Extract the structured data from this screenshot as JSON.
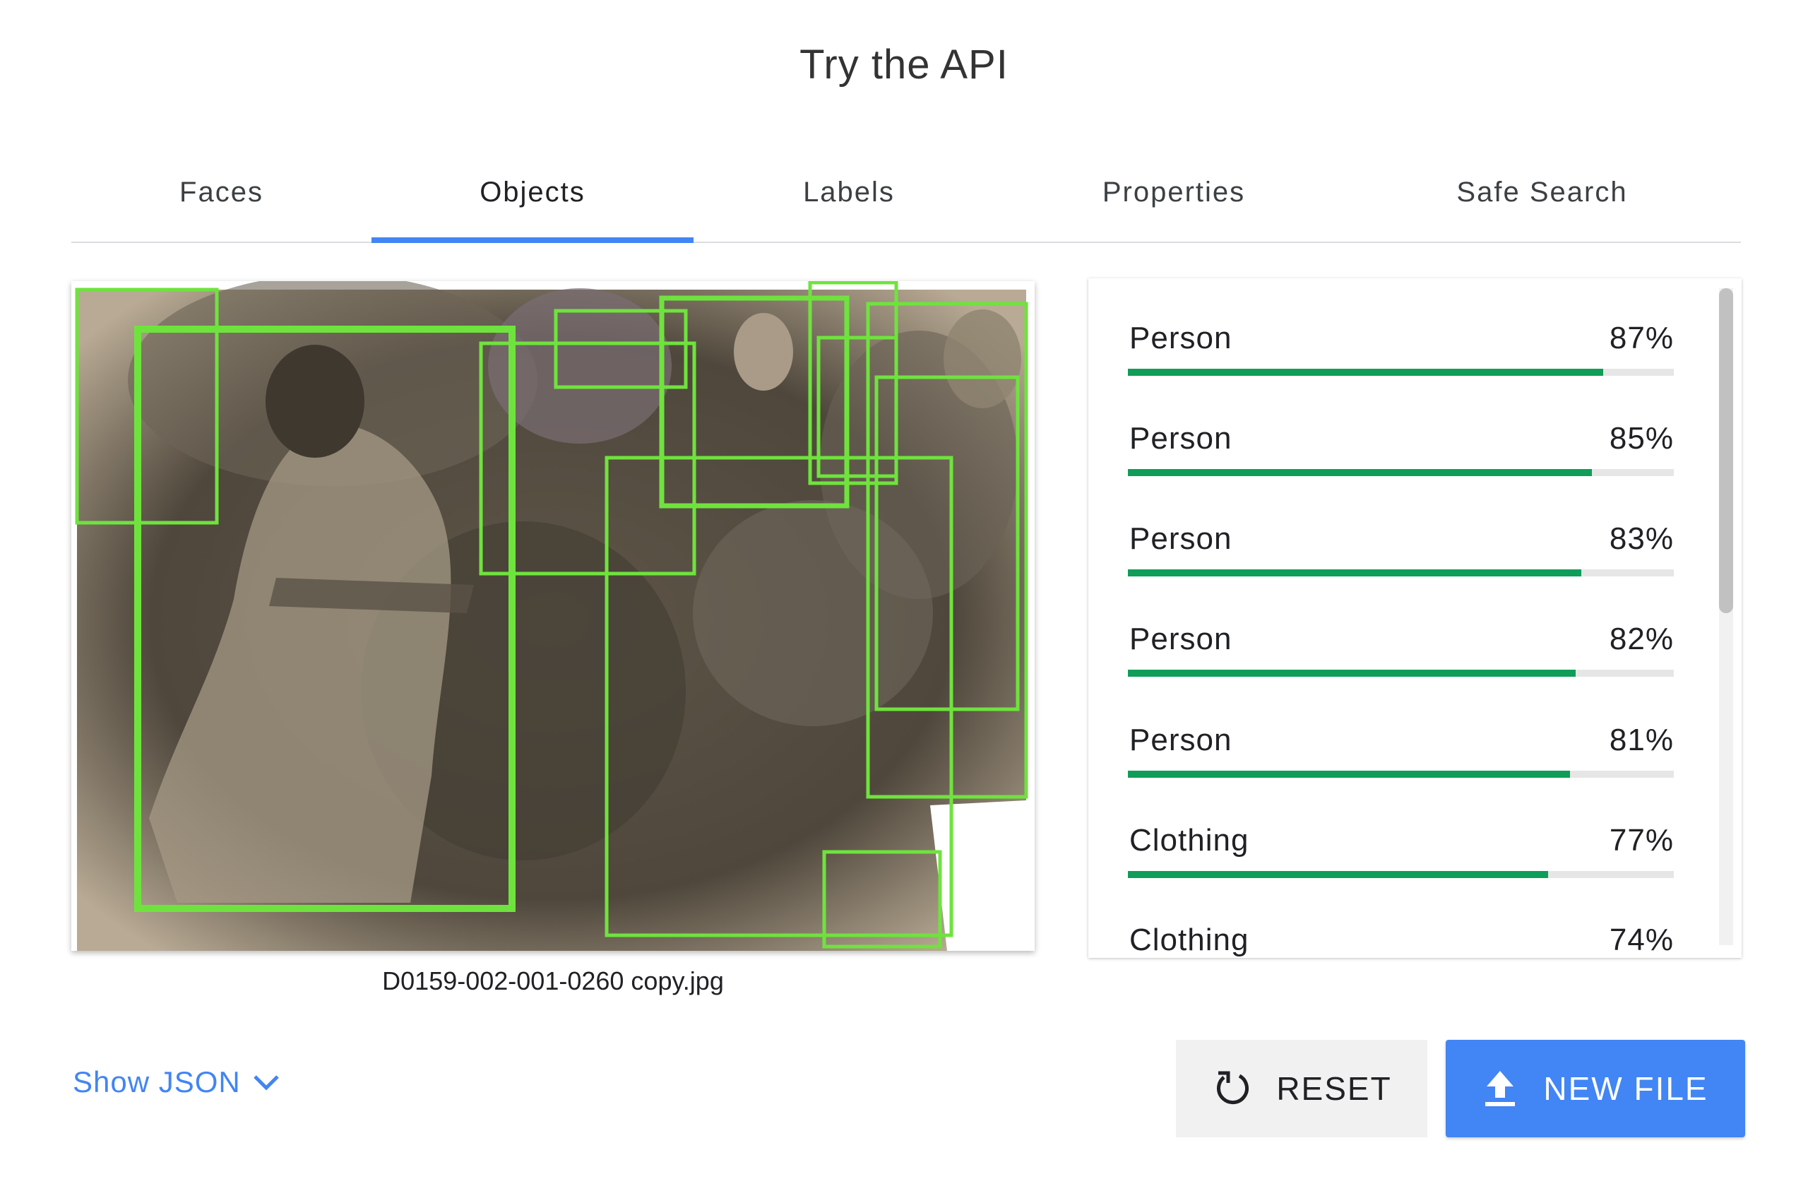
{
  "page": {
    "title": "Try the API"
  },
  "tabs": [
    {
      "label": "Faces",
      "active": false
    },
    {
      "label": "Objects",
      "active": true
    },
    {
      "label": "Labels",
      "active": false
    },
    {
      "label": "Properties",
      "active": false
    },
    {
      "label": "Safe Search",
      "active": false
    }
  ],
  "image": {
    "filename": "D0159-002-001-0260 copy.jpg",
    "photo_style": "sepia vintage photograph of a group of people",
    "box_color": "#6fe33d"
  },
  "results": [
    {
      "name": "Person",
      "percent_label": "87%",
      "score": 0.87
    },
    {
      "name": "Person",
      "percent_label": "85%",
      "score": 0.85
    },
    {
      "name": "Person",
      "percent_label": "83%",
      "score": 0.83
    },
    {
      "name": "Person",
      "percent_label": "82%",
      "score": 0.82
    },
    {
      "name": "Person",
      "percent_label": "81%",
      "score": 0.81
    },
    {
      "name": "Clothing",
      "percent_label": "77%",
      "score": 0.77
    },
    {
      "name": "Clothing",
      "percent_label": "74%",
      "score": 0.74
    }
  ],
  "bar_color": "#0f9d58",
  "accent_color": "#4285f4",
  "footer": {
    "show_json": "Show JSON",
    "show_json_icon": "chevron-down-icon",
    "reset": "RESET",
    "reset_icon": "reset-icon",
    "new_file": "NEW FILE",
    "new_file_icon": "upload-icon"
  }
}
